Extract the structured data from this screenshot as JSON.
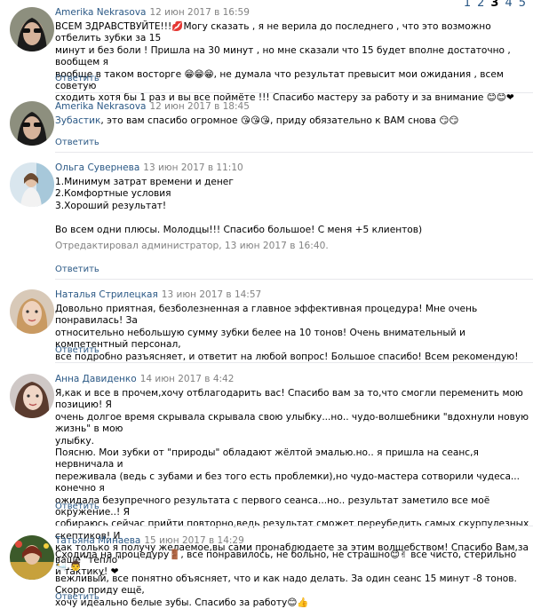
{
  "pagination": {
    "pages": [
      "1",
      "2",
      "3",
      "4",
      "5"
    ],
    "current": "3"
  },
  "reply_label": "Ответить",
  "comments": [
    {
      "author": "Amerika Nekrasova",
      "date": "12 июн 2017 в 16:59",
      "lines": [
        "ВСЕМ ЗДРАВСТВУЙТЕ!!!💋Могу сказать , я не верила до последнего , что это возможно отбелить зубки за 15",
        "минут и без боли ! Пришла на 30 минут , но мне сказали что 15 будет вполне достаточно , вообщем я",
        "вообще в таком восторге 😁😁😁, не думала что результат превысит мои ожидания , всем советую",
        "сходить хотя бы 1 раз и вы все поймёте !!! Спасибо мастеру за работу и за внимание 😊😊❤"
      ]
    },
    {
      "author": "Amerika Nekrasova",
      "date": "12 июн 2017 в 18:45",
      "mention": "Зубастик",
      "lines": [
        ", это вам спасибо огромное 😘😘😘, приду обязательно к ВАМ снова 😏😏"
      ]
    },
    {
      "author": "Ольга Сувернева",
      "date": "13 июн 2017 в 11:10",
      "lines": [
        "1.Минимум затрат времени и денег",
        "2.Комфортные условия",
        "3.Хороший результат!",
        "",
        "Во всем одни плюсы. Молодцы!!! Спасибо большое! С меня +5 клиентов)"
      ],
      "edited": "Отредактировал администратор, 13 июн 2017 в 16:40."
    },
    {
      "author": "Наталья Стрилецкая",
      "date": "13 июн 2017 в 14:57",
      "lines": [
        "Довольно приятная, безболезненная а главное эффективная процедура! Мне очень понравилась! За",
        "относительно небольшую сумму зубки белее на 10 тонов! Очень внимательный и компетентный персонал,",
        "все подробно разъясняет, и ответит на любой вопрос! Большое спасибо! Всем рекомендую!"
      ]
    },
    {
      "author": "Анна Давиденко",
      "date": "14 июн 2017 в 4:42",
      "lines": [
        "Я,как и все в прочем,хочу отблагодарить вас! Спасибо вам за то,что смогли переменить мою позицию! Я",
        "очень долгое время скрывала скрывала свою улыбку...но.. чудо-волшебники \"вдохнули новую жизнь\" в мою",
        "улыбку.",
        "Поясню. Мои зубки от \"природы\" обладают жёлтой эмалью.но.. я пришла на сеанс,я нервничала и",
        "переживала (ведь с зубами и без того есть проблемки),но чудо-мастера сотворили чудеса... конечно я",
        "ожидала безупречного результата с первого сеанса...но.. результат заметило все моё окружение..! Я",
        "собираюсь сейчас прийти повторно,ведь результат сможет переубедить самых скурпулезных скептиков! И",
        "как только я получу желаемое,вы сами  пронаблюдаете за этим волшебством! Спасибо Вам,за ваше \"тепло\"",
        "и тактику! ❤"
      ]
    },
    {
      "author": "Татьяна Минаева",
      "date": "15 июн 2017 в 14:29",
      "lines": [
        "Сходила на процедуру🚪, все понравилось, не больно, не страшно😊✌ все чисто, стерильно🛀,👨",
        "вежливый, все понятно объясняет, что и как надо делать. За один сеанс 15 минут -8 тонов. Скоро приду ещё,",
        "хочу идеально белые зубы. Спасибо за работу😊👍"
      ]
    }
  ]
}
